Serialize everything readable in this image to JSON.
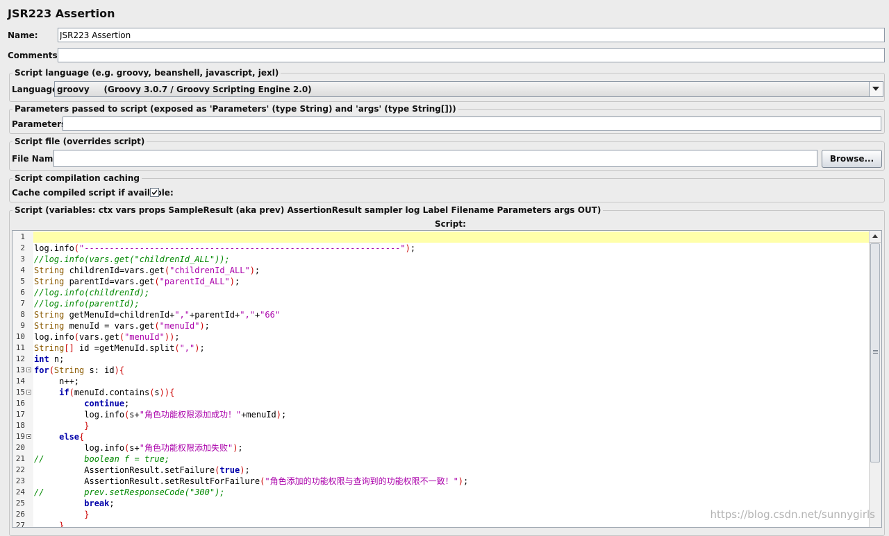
{
  "window": {
    "title": "JSR223 Assertion"
  },
  "name_field": {
    "label": "Name:",
    "value": "JSR223 Assertion"
  },
  "comments_field": {
    "label": "Comments:",
    "value": ""
  },
  "script_language": {
    "group_title": "Script language (e.g. groovy, beanshell, javascript, jexl)",
    "label": "Language:",
    "selected": "groovy     (Groovy 3.0.7 / Groovy Scripting Engine 2.0)"
  },
  "parameters": {
    "group_title": "Parameters passed to script (exposed as 'Parameters' (type String) and 'args' (type String[]))",
    "label": "Parameters:",
    "value": ""
  },
  "script_file": {
    "group_title": "Script file (overrides script)",
    "label": "File Name:",
    "value": "",
    "browse_label": "Browse..."
  },
  "caching": {
    "group_title": "Script compilation caching",
    "label": "Cache compiled script if available:",
    "checked": true
  },
  "script": {
    "group_title": "Script (variables: ctx vars props SampleResult (aka prev) AssertionResult sampler log Label Filename Parameters args OUT)",
    "header": "Script:",
    "colors": {
      "keyword": "#0000aa",
      "type": "#8a5a00",
      "string": "#aa00aa",
      "comment": "#008800",
      "bracket": "#cc0000",
      "current_line": "#ffffaa"
    },
    "lines": [
      {
        "n": "1",
        "fold": false,
        "code": ""
      },
      {
        "n": "2",
        "fold": false,
        "code": "log.info(\"---------------------------------------------------------------\");"
      },
      {
        "n": "3",
        "fold": false,
        "code": "//log.info(vars.get(\"childrenId_ALL\"));"
      },
      {
        "n": "4",
        "fold": false,
        "code": "String childrenId=vars.get(\"childrenId_ALL\");"
      },
      {
        "n": "5",
        "fold": false,
        "code": "String parentId=vars.get(\"parentId_ALL\");"
      },
      {
        "n": "6",
        "fold": false,
        "code": "//log.info(childrenId);"
      },
      {
        "n": "7",
        "fold": false,
        "code": "//log.info(parentId);"
      },
      {
        "n": "8",
        "fold": false,
        "code": "String getMenuId=childrenId+\",\"+parentId+\",\"+\"66\""
      },
      {
        "n": "9",
        "fold": false,
        "code": "String menuId = vars.get(\"menuId\");"
      },
      {
        "n": "10",
        "fold": false,
        "code": "log.info(vars.get(\"menuId\"));"
      },
      {
        "n": "11",
        "fold": false,
        "code": "String[] id =getMenuId.split(\",\");"
      },
      {
        "n": "12",
        "fold": false,
        "code": "int n;"
      },
      {
        "n": "13",
        "fold": true,
        "code": "for(String s: id){"
      },
      {
        "n": "14",
        "fold": false,
        "code": "     n++;"
      },
      {
        "n": "15",
        "fold": true,
        "code": "     if(menuId.contains(s)){"
      },
      {
        "n": "16",
        "fold": false,
        "code": "          continue;"
      },
      {
        "n": "17",
        "fold": false,
        "code": "          log.info(s+\"角色功能权限添加成功！\"+menuId);"
      },
      {
        "n": "18",
        "fold": false,
        "code": "          }"
      },
      {
        "n": "19",
        "fold": true,
        "code": "     else{"
      },
      {
        "n": "20",
        "fold": false,
        "code": "          log.info(s+\"角色功能权限添加失败\");"
      },
      {
        "n": "21",
        "fold": false,
        "code": "//        boolean f = true;"
      },
      {
        "n": "22",
        "fold": false,
        "code": "          AssertionResult.setFailure(true);"
      },
      {
        "n": "23",
        "fold": false,
        "code": "          AssertionResult.setResultForFailure(\"角色添加的功能权限与查询到的功能权限不一致！\");"
      },
      {
        "n": "24",
        "fold": false,
        "code": "//        prev.setResponseCode(\"300\");"
      },
      {
        "n": "25",
        "fold": false,
        "code": "          break;"
      },
      {
        "n": "26",
        "fold": false,
        "code": "          }"
      },
      {
        "n": "27",
        "fold": false,
        "code": "     }"
      }
    ]
  },
  "watermark": "https://blog.csdn.net/sunnygirls"
}
